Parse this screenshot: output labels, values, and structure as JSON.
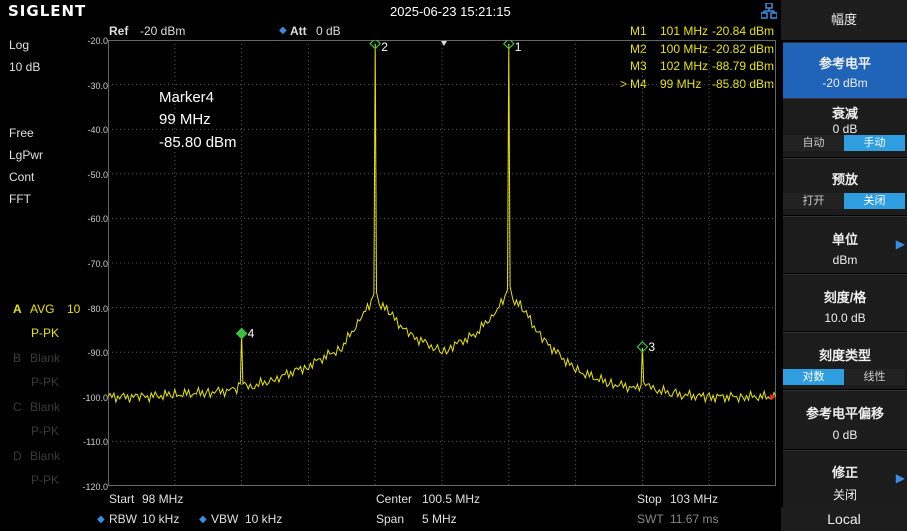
{
  "brand": "SIGLENT",
  "datetime": "2025-06-23 15:21:15",
  "left_panel": {
    "scale_type": "Log",
    "scale_div": "10 dB",
    "free": "Free",
    "detector": "LgPwr",
    "sweep_mode": "Cont",
    "fft": "FFT",
    "traces": [
      {
        "id": "A",
        "mode": "AVG",
        "count": "10",
        "detector": "P-PK",
        "active": true
      },
      {
        "id": "B",
        "mode": "Blank",
        "count": "",
        "detector": "P-PK",
        "active": false
      },
      {
        "id": "C",
        "mode": "Blank",
        "count": "",
        "detector": "P-PK",
        "active": false
      },
      {
        "id": "D",
        "mode": "Blank",
        "count": "",
        "detector": "P-PK",
        "active": false
      }
    ]
  },
  "header": {
    "ref_label": "Ref",
    "ref_value": "-20 dBm",
    "att_label": "Att",
    "att_value": "0 dB"
  },
  "marker_table": [
    {
      "prefix": "",
      "name": "M1",
      "freq": "101 MHz",
      "level": "-20.84 dBm"
    },
    {
      "prefix": "",
      "name": "M2",
      "freq": "100 MHz",
      "level": "-20.82 dBm"
    },
    {
      "prefix": "",
      "name": "M3",
      "freq": "102 MHz",
      "level": "-88.79 dBm"
    },
    {
      "prefix": ">",
      "name": "M4",
      "freq": "99 MHz",
      "level": "-85.80 dBm"
    }
  ],
  "active_marker": {
    "name": "Marker4",
    "freq": "99 MHz",
    "level": "-85.80 dBm"
  },
  "y_ticks": [
    "-20.0",
    "-30.0",
    "-40.0",
    "-50.0",
    "-60.0",
    "-70.0",
    "-80.0",
    "-90.0",
    "-100.0",
    "-110.0",
    "-120.0"
  ],
  "bottom": {
    "start_label": "Start",
    "start_value": "98 MHz",
    "center_label": "Center",
    "center_value": "100.5 MHz",
    "stop_label": "Stop",
    "stop_value": "103 MHz",
    "rbw_label": "RBW",
    "rbw_value": "10 kHz",
    "vbw_label": "VBW",
    "vbw_value": "10 kHz",
    "span_label": "Span",
    "span_value": "5 MHz",
    "swt_label": "SWT",
    "swt_value": "11.67 ms"
  },
  "chart_data": {
    "type": "line",
    "xlim": [
      98,
      103
    ],
    "ylim": [
      -120,
      -20
    ],
    "x_unit": "MHz",
    "y_unit": "dBm",
    "grid": true,
    "trace_color": "#e8e400",
    "x": [
      98.0,
      98.25,
      98.5,
      98.75,
      98.95,
      98.99,
      99.0,
      99.01,
      99.05,
      99.25,
      99.5,
      99.75,
      99.9,
      99.97,
      99.99,
      100.0,
      100.01,
      100.03,
      100.1,
      100.25,
      100.45,
      100.5,
      100.55,
      100.75,
      100.9,
      100.97,
      100.99,
      101.0,
      101.01,
      101.03,
      101.1,
      101.25,
      101.5,
      101.75,
      101.95,
      101.99,
      102.0,
      102.01,
      102.05,
      102.25,
      102.5,
      102.75,
      103.0
    ],
    "y": [
      -100,
      -100,
      -99.5,
      -99,
      -98.5,
      -97,
      -85.8,
      -97,
      -98,
      -96,
      -93,
      -89,
      -82,
      -79,
      -77,
      -20.82,
      -77,
      -79,
      -81,
      -86,
      -89,
      -90,
      -89,
      -86,
      -81,
      -78,
      -76,
      -20.84,
      -76,
      -78,
      -80,
      -87,
      -94,
      -97,
      -98,
      -97,
      -88.79,
      -97,
      -98,
      -99.5,
      -100,
      -100,
      -100
    ],
    "markers": [
      {
        "label": "1",
        "x": 101,
        "y": -20.84,
        "color": "#3cc040"
      },
      {
        "label": "2",
        "x": 100,
        "y": -20.82,
        "color": "#3cc040"
      },
      {
        "label": "3",
        "x": 102,
        "y": -88.79,
        "color": "#3cc040"
      },
      {
        "label": "4",
        "x": 99,
        "y": -85.8,
        "color": "#3cc040"
      }
    ]
  },
  "softkeys": {
    "menu_title": "幅度",
    "ref_level": {
      "label": "参考电平",
      "value": "-20 dBm"
    },
    "atten": {
      "label": "衰减",
      "value": "0 dB",
      "opt_a": "自动",
      "opt_b": "手动"
    },
    "preamp": {
      "label": "预放",
      "opt_a": "打开",
      "opt_b": "关闭"
    },
    "units": {
      "label": "单位",
      "value": "dBm"
    },
    "scale_div": {
      "label": "刻度/格",
      "value": "10.0 dB"
    },
    "scale_type": {
      "label": "刻度类型",
      "opt_a": "对数",
      "opt_b": "线性"
    },
    "ref_offset": {
      "label": "参考电平偏移",
      "value": "0 dB"
    },
    "correction": {
      "label": "修正",
      "value": "关闭"
    },
    "local": "Local"
  }
}
